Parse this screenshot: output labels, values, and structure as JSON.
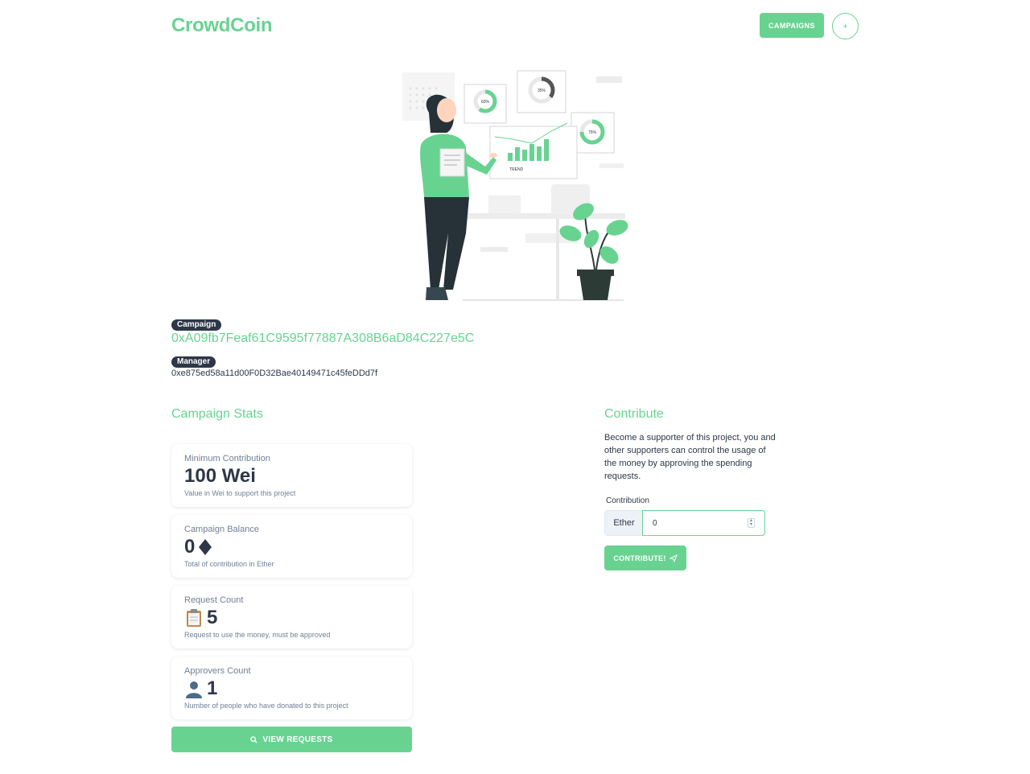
{
  "header": {
    "logo": "CrowdCoin",
    "campaigns_button": "CAMPAIGNS",
    "add_button": "+"
  },
  "hero": {
    "chart_labels": [
      "60%",
      "35%",
      "75%"
    ],
    "trend_label": "TREND"
  },
  "campaign": {
    "badge": "Campaign",
    "address": "0xA09fb7Feaf61C9595f77887A308B6aD84C227e5C"
  },
  "manager": {
    "badge": "Manager",
    "address": "0xe875ed58a11d00F0D32Bae40149471c45feDDd7f"
  },
  "stats": {
    "title": "Campaign Stats",
    "cards": [
      {
        "label": "Minimum Contribution",
        "value": "100 Wei",
        "icon": "",
        "help": "Value in Wei to support this project"
      },
      {
        "label": "Campaign Balance",
        "value": "0",
        "icon": "ether-diamond-icon",
        "help": "Total of contribution in Ether"
      },
      {
        "label": "Request Count",
        "value": "5",
        "icon": "clipboard-icon",
        "help": "Request to use the money, must be approved"
      },
      {
        "label": "Approvers Count",
        "value": "1",
        "icon": "person-icon",
        "help": "Number of people who have donated to this project"
      }
    ],
    "view_requests_button": "VIEW REQUESTS"
  },
  "contribute": {
    "title": "Contribute",
    "description": "Become a supporter of this project, you and other supporters can control the usage of the money by approving the spending requests.",
    "field_label": "Contribution",
    "unit_addon": "Ether",
    "input_value": "0",
    "button": "CONTRIBUTE!"
  },
  "colors": {
    "accent": "#68d391",
    "dark": "#2d3748",
    "muted": "#718096"
  }
}
